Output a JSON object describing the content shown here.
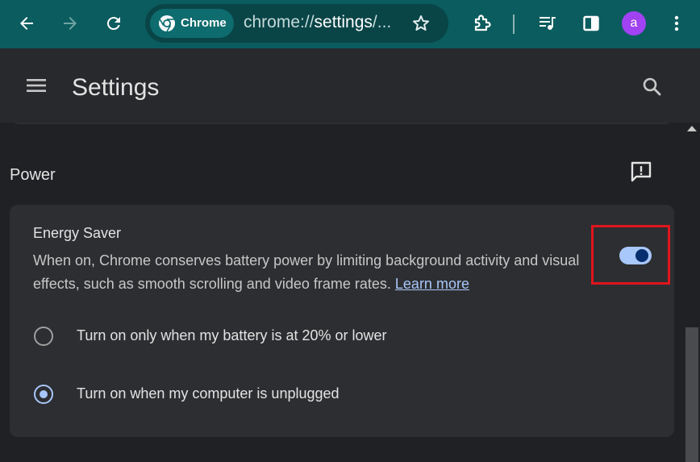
{
  "browser": {
    "chip_label": "Chrome",
    "url_prefix": "chrome://",
    "url_host": "settings",
    "url_suffix": "/...",
    "avatar_letter": "a"
  },
  "header": {
    "title": "Settings"
  },
  "power": {
    "section_title": "Power",
    "energy_saver": {
      "title": "Energy Saver",
      "description": "When on, Chrome conserves battery power by limiting background activity and visual effects, such as smooth scrolling and video frame rates.",
      "learn_more": "Learn more",
      "enabled": true
    },
    "options": [
      {
        "label": "Turn on only when my battery is at 20% or lower",
        "selected": false
      },
      {
        "label": "Turn on when my computer is unplugged",
        "selected": true
      }
    ]
  },
  "colors": {
    "toolbar": "#0b5c5e",
    "accent": "#a8c7fa",
    "highlight": "#e0151e"
  }
}
